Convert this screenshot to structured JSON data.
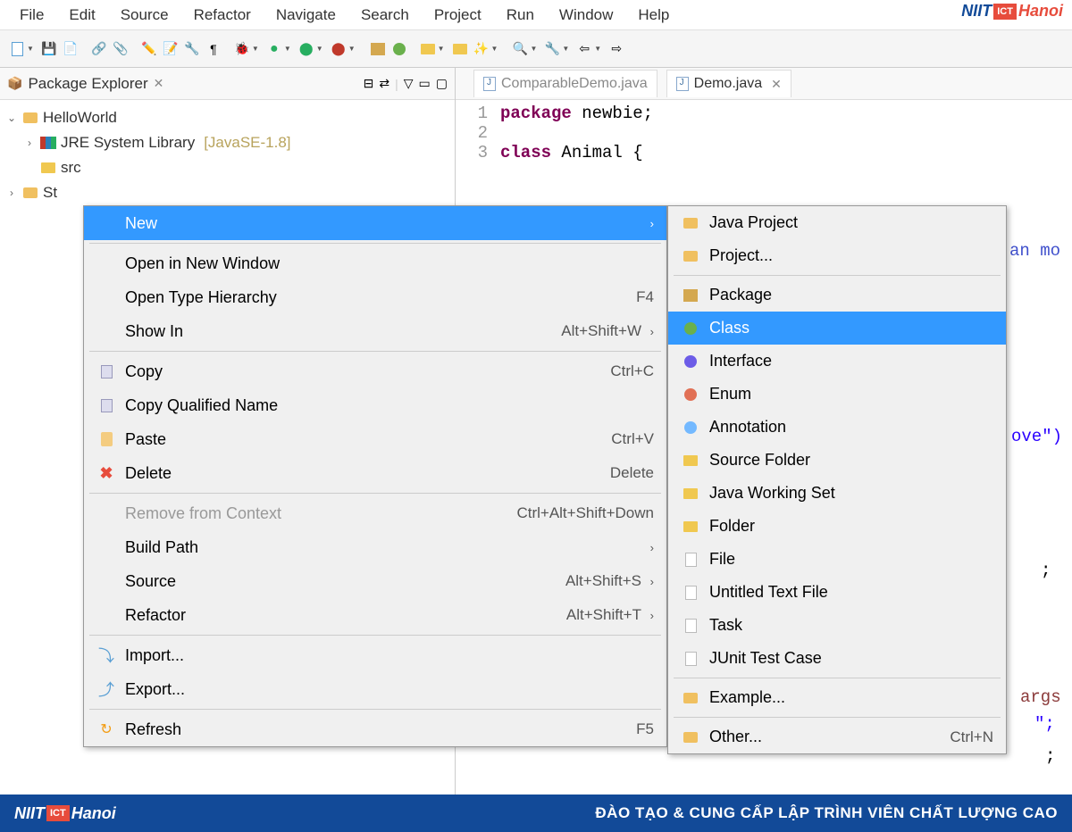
{
  "menubar": [
    "File",
    "Edit",
    "Source",
    "Refactor",
    "Navigate",
    "Search",
    "Project",
    "Run",
    "Window",
    "Help"
  ],
  "logo": {
    "niit": "NIIT",
    "ict": "ICT",
    "hanoi": "Hanoi"
  },
  "sidebar": {
    "title": "Package Explorer",
    "tree": {
      "project": "HelloWorld",
      "jre_label": "JRE System Library",
      "jre_version": "[JavaSE-1.8]",
      "src": "src",
      "st": "St"
    }
  },
  "tabs": {
    "inactive": "ComparableDemo.java",
    "active": "Demo.java"
  },
  "code": {
    "l1_kw": "package",
    "l1_txt": " newbie;",
    "l3_kw": "class",
    "l3_txt": " Animal {",
    "partial1": "an mo",
    "partial2": "ove\")",
    "partial3": ";",
    "partial4": "args",
    "partial5": "\";",
    "partial6": ";"
  },
  "context_menu": [
    {
      "label": "New",
      "shortcut": "",
      "arrow": true,
      "highlighted": true,
      "sep_after": true
    },
    {
      "label": "Open in New Window",
      "shortcut": ""
    },
    {
      "label": "Open Type Hierarchy",
      "shortcut": "F4"
    },
    {
      "label": "Show In",
      "shortcut": "Alt+Shift+W",
      "arrow": true,
      "sep_after": true
    },
    {
      "label": "Copy",
      "shortcut": "Ctrl+C",
      "icon": "copy"
    },
    {
      "label": "Copy Qualified Name",
      "shortcut": "",
      "icon": "copy"
    },
    {
      "label": "Paste",
      "shortcut": "Ctrl+V",
      "icon": "paste"
    },
    {
      "label": "Delete",
      "shortcut": "Delete",
      "icon": "x",
      "sep_after": true
    },
    {
      "label": "Remove from Context",
      "shortcut": "Ctrl+Alt+Shift+Down",
      "disabled": true
    },
    {
      "label": "Build Path",
      "shortcut": "",
      "arrow": true
    },
    {
      "label": "Source",
      "shortcut": "Alt+Shift+S",
      "arrow": true
    },
    {
      "label": "Refactor",
      "shortcut": "Alt+Shift+T",
      "arrow": true,
      "sep_after": true
    },
    {
      "label": "Import...",
      "shortcut": "",
      "icon": "import"
    },
    {
      "label": "Export...",
      "shortcut": "",
      "icon": "export",
      "sep_after": true
    },
    {
      "label": "Refresh",
      "shortcut": "F5",
      "icon": "refresh"
    }
  ],
  "submenu": [
    {
      "label": "Java Project",
      "icon": "proj"
    },
    {
      "label": "Project...",
      "icon": "proj",
      "sep_after": true
    },
    {
      "label": "Package",
      "icon": "pkg"
    },
    {
      "label": "Class",
      "icon": "class",
      "highlighted": true
    },
    {
      "label": "Interface",
      "icon": "iface"
    },
    {
      "label": "Enum",
      "icon": "enum"
    },
    {
      "label": "Annotation",
      "icon": "ann"
    },
    {
      "label": "Source Folder",
      "icon": "folder"
    },
    {
      "label": "Java Working Set",
      "icon": "folder"
    },
    {
      "label": "Folder",
      "icon": "folder"
    },
    {
      "label": "File",
      "icon": "file"
    },
    {
      "label": "Untitled Text File",
      "icon": "file"
    },
    {
      "label": "Task",
      "icon": "file"
    },
    {
      "label": "JUnit Test Case",
      "icon": "file",
      "sep_after": true
    },
    {
      "label": "Example...",
      "icon": "proj",
      "sep_after": true
    },
    {
      "label": "Other...",
      "icon": "proj",
      "shortcut": "Ctrl+N"
    }
  ],
  "footer": "ĐÀO TẠO & CUNG CẤP LẬP TRÌNH VIÊN CHẤT LƯỢNG CAO"
}
